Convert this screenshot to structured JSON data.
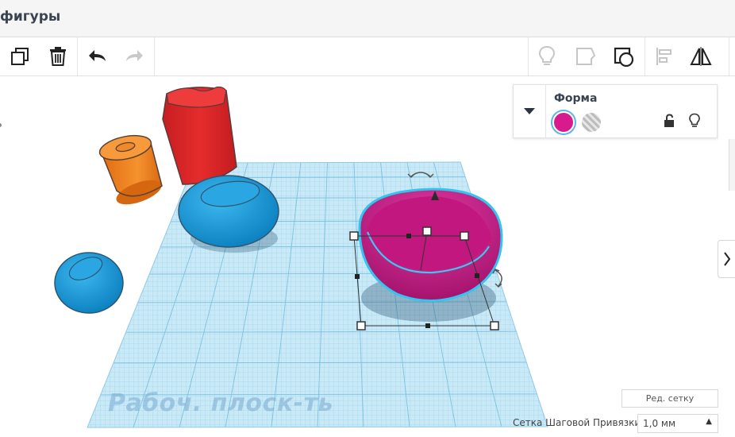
{
  "window": {
    "title": "фигуры"
  },
  "toolbar": {
    "duplicate_icon": "copy-icon",
    "delete_icon": "trash-icon",
    "undo_icon": "undo-icon",
    "redo_icon": "redo-icon",
    "right_tools": [
      "bulb-icon",
      "note-icon",
      "view-icon",
      "align-icon",
      "mirror-icon"
    ]
  },
  "inspector": {
    "title": "Форма",
    "solid_color": "#d81b8c",
    "hole_swatch": "hole-pattern"
  },
  "workplane": {
    "label": "Рабоч. плоск-ть",
    "edit_grid_label": "Ред. сетку",
    "snap_label": "Сетка Шаговой Привязки",
    "snap_value": "1,0 мм"
  },
  "colors": {
    "grid": "#9fd6ee",
    "cylinder": "#f07f1e",
    "box": "#e02a2a",
    "blue_shape": "#1799d6",
    "selected_shape": "#c0167f",
    "selection_outline": "#33c4f0"
  }
}
